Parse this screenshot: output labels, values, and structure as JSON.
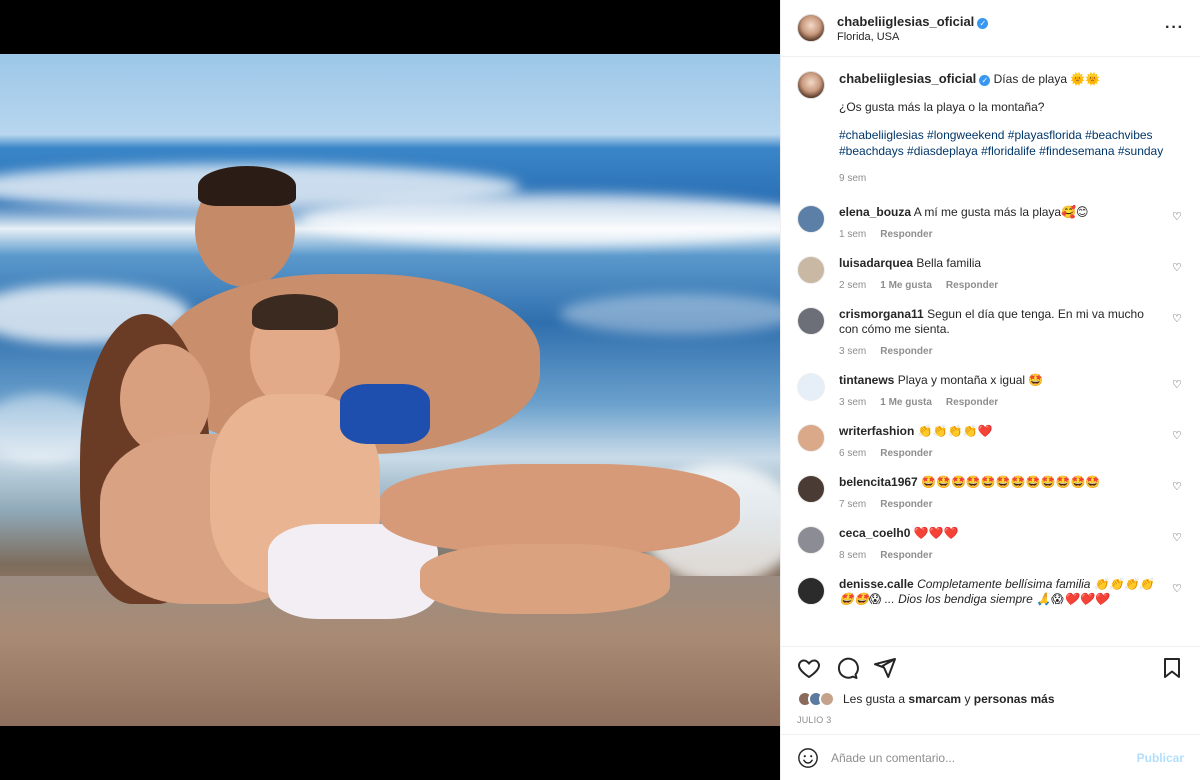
{
  "post": {
    "username": "chabeliiglesias_oficial",
    "location": "Florida, USA",
    "caption_title": "Días de playa 🌞🌞",
    "caption_question": "¿Os gusta más la playa o la montaña?",
    "hashtags": "#chabeliiglesias #longweekend #playasflorida #beachvibes #beachdays #diasdeplaya #floridalife #findesemana #sunday",
    "caption_time": "9 sem"
  },
  "comments": [
    {
      "user": "elena_bouza",
      "text": "A mí me gusta más la playa🥰😊",
      "time": "1 sem",
      "likes": "",
      "reply": "Responder",
      "avatar_color": "#5b7fa6"
    },
    {
      "user": "luisadarquea",
      "text": "Bella familia",
      "time": "2 sem",
      "likes": "1 Me gusta",
      "reply": "Responder",
      "avatar_color": "#c9b8a4"
    },
    {
      "user": "crismorgana11",
      "text": "Segun el día que tenga. En mi va mucho con cómo me sienta.",
      "time": "3 sem",
      "likes": "",
      "reply": "Responder",
      "avatar_color": "#6c6f78"
    },
    {
      "user": "tintanews",
      "text": "Playa y montaña x igual 🤩",
      "time": "3 sem",
      "likes": "1 Me gusta",
      "reply": "Responder",
      "avatar_color": "#e6eef7"
    },
    {
      "user": "writerfashion",
      "text": "👏👏👏👏❤️",
      "time": "6 sem",
      "likes": "",
      "reply": "Responder",
      "avatar_color": "#d9a98a"
    },
    {
      "user": "belencita1967",
      "text": "🤩🤩🤩🤩🤩🤩🤩🤩🤩🤩🤩🤩",
      "time": "7 sem",
      "likes": "",
      "reply": "Responder",
      "avatar_color": "#4a3b34"
    },
    {
      "user": "ceca_coelh0",
      "text": "❤️❤️❤️",
      "time": "8 sem",
      "likes": "",
      "reply": "Responder",
      "avatar_color": "#8c8c94"
    },
    {
      "user": "denisse.calle",
      "text": "Completamente bellísima familia 👏👏👏👏 🤩🤩😱 ... Dios los bendiga siempre 🙏😱❤️❤️❤️",
      "time": "",
      "likes": "",
      "reply": "",
      "avatar_color": "#2b2b2b"
    }
  ],
  "likes": {
    "prefix": "Les gusta a",
    "user": "smarcam",
    "connector": "y",
    "others": "personas más"
  },
  "date": "JULIO 3",
  "add_comment": {
    "placeholder": "Añade un comentario...",
    "publish": "Publicar"
  },
  "colors": {
    "link": "#00376b",
    "verified": "#3897f0",
    "publish_disabled": "#b2dffc"
  }
}
